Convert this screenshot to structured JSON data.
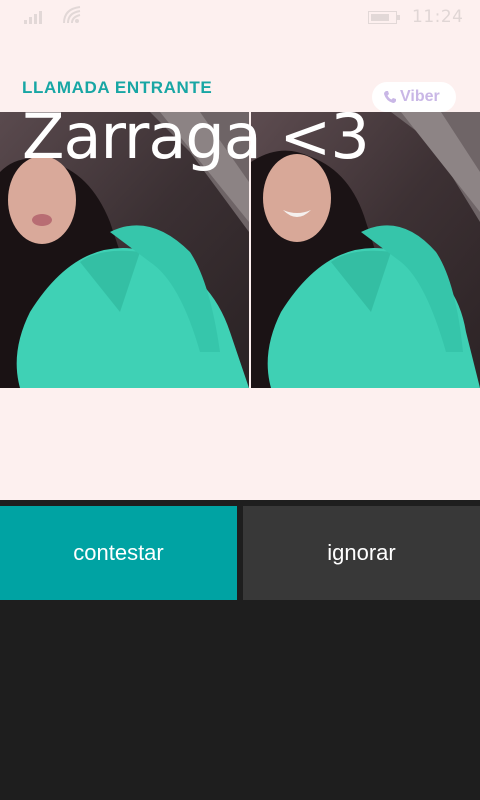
{
  "status_bar": {
    "time": "11:24",
    "icons": [
      "signal-icon",
      "wifi-icon",
      "battery-icon"
    ]
  },
  "call": {
    "label": "LLAMADA ENTRANTE",
    "caller_name": "Zarraga <3",
    "app_badge": "Viber"
  },
  "actions": {
    "answer_label": "contestar",
    "ignore_label": "ignorar"
  },
  "colors": {
    "accent": "#18a6a4",
    "answer_button": "#00a3a3",
    "ignore_button": "#383838",
    "background_top": "#fdf0ef",
    "background_bottom": "#1e1e1e"
  }
}
